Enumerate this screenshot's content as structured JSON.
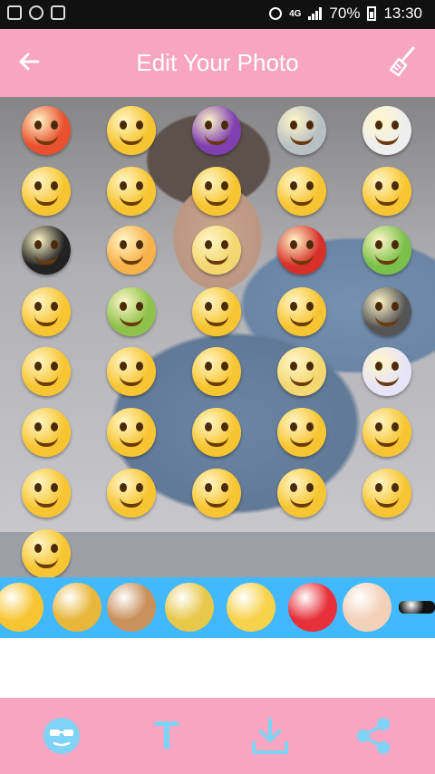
{
  "status_bar": {
    "network": "4G",
    "battery": "70%",
    "time": "13:30",
    "icons": [
      "image-icon",
      "whatsapp-icon",
      "wifi-icon",
      "alarm-icon",
      "signal-icon",
      "battery-icon"
    ]
  },
  "app_bar": {
    "title": "Edit Your Photo",
    "back_icon": "arrow-left-icon",
    "clear_icon": "broom-icon"
  },
  "emoji_grid": [
    {
      "name": "angry-emoji",
      "color": "#e8502e"
    },
    {
      "name": "wink-emoji",
      "color": "#f7c531"
    },
    {
      "name": "devil-emoji",
      "color": "#7f3fb0"
    },
    {
      "name": "alien-emoji",
      "color": "#b9c0c4"
    },
    {
      "name": "skull-emoji",
      "color": "#eeeeee"
    },
    {
      "name": "yum-emoji",
      "color": "#f7c531"
    },
    {
      "name": "sunglasses-emoji",
      "color": "#f7c531"
    },
    {
      "name": "heart-eyes-emoji",
      "color": "#f7c531"
    },
    {
      "name": "kiss-wink-emoji",
      "color": "#f7c531"
    },
    {
      "name": "angel-emoji",
      "color": "#f7c531"
    },
    {
      "name": "bomb-emoji",
      "color": "#222222"
    },
    {
      "name": "heart-eyes-blush-emoji",
      "color": "#f7b24a"
    },
    {
      "name": "frustrated-emoji",
      "color": "#f3d871"
    },
    {
      "name": "rage-emoji",
      "color": "#d7302a"
    },
    {
      "name": "nauseated-emoji",
      "color": "#7bc04b"
    },
    {
      "name": "dizzy-emoji",
      "color": "#f7c531"
    },
    {
      "name": "drinking-emoji",
      "color": "#8fc24a"
    },
    {
      "name": "smirk-emoji",
      "color": "#f7c531"
    },
    {
      "name": "laughing-emoji",
      "color": "#f7c531"
    },
    {
      "name": "grimace-emoji",
      "color": "#555555"
    },
    {
      "name": "worried-emoji",
      "color": "#f7c531"
    },
    {
      "name": "phone-emoji",
      "color": "#f7c531"
    },
    {
      "name": "cocktail-emoji",
      "color": "#f7c531"
    },
    {
      "name": "coffee-emoji",
      "color": "#f3d871"
    },
    {
      "name": "cold-emoji",
      "color": "#e8e4f8"
    },
    {
      "name": "cool-emoji",
      "color": "#f7c531"
    },
    {
      "name": "smile-emoji",
      "color": "#f7c531"
    },
    {
      "name": "halo-emoji",
      "color": "#f7c531"
    },
    {
      "name": "grin-emoji",
      "color": "#f7c531"
    },
    {
      "name": "kiss-emoji",
      "color": "#f7c531"
    },
    {
      "name": "flushed-emoji",
      "color": "#f7c531"
    },
    {
      "name": "grimacing-emoji",
      "color": "#f7c531"
    },
    {
      "name": "unamused-emoji",
      "color": "#f7c531"
    },
    {
      "name": "tongue-wink-emoji",
      "color": "#f7c531"
    },
    {
      "name": "squint-tongue-emoji",
      "color": "#f7c531"
    },
    {
      "name": "squint-laugh-emoji",
      "color": "#f7c531"
    }
  ],
  "sticker_strip": [
    {
      "name": "heart-eyes-sticker",
      "color": "#f7c531"
    },
    {
      "name": "cap-sticker",
      "color": "#e8b63a"
    },
    {
      "name": "monkey-sticker",
      "color": "#c8905a"
    },
    {
      "name": "bath-chick-sticker",
      "color": "#e8c84a"
    },
    {
      "name": "love-you-sticker",
      "color": "#f7d24a"
    },
    {
      "name": "love-balloon-sticker",
      "color": "#e8303a"
    },
    {
      "name": "girl-sticker",
      "color": "#f3d0b8"
    },
    {
      "name": "sunglasses-sticker",
      "color": "#111111"
    }
  ],
  "toolbar": {
    "items": [
      "face-icon",
      "text-icon",
      "download-icon",
      "share-icon"
    ],
    "text_label": "T",
    "accent": "#7fd3f5"
  },
  "colors": {
    "pink": "#f8a5c2",
    "strip_blue": "#41b8ff"
  }
}
